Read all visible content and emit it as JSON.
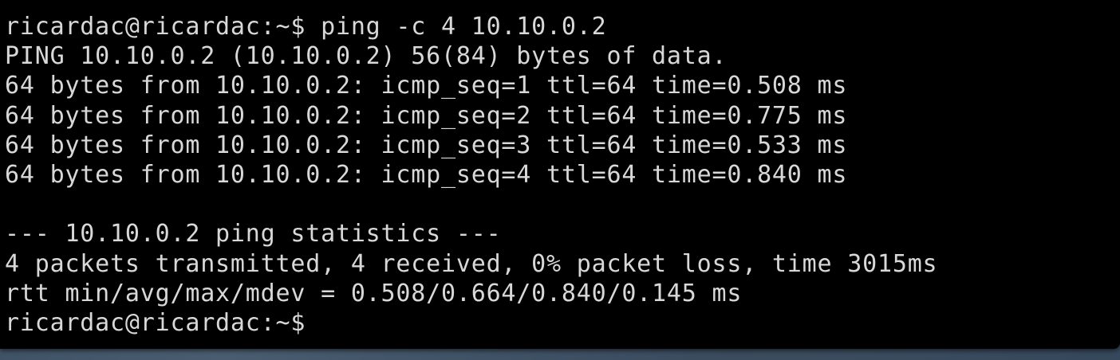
{
  "terminal": {
    "lines": [
      "ricardac@ricardac:~$ ping -c 4 10.10.0.2",
      "PING 10.10.0.2 (10.10.0.2) 56(84) bytes of data.",
      "64 bytes from 10.10.0.2: icmp_seq=1 ttl=64 time=0.508 ms",
      "64 bytes from 10.10.0.2: icmp_seq=2 ttl=64 time=0.775 ms",
      "64 bytes from 10.10.0.2: icmp_seq=3 ttl=64 time=0.533 ms",
      "64 bytes from 10.10.0.2: icmp_seq=4 ttl=64 time=0.840 ms",
      "",
      "--- 10.10.0.2 ping statistics ---",
      "4 packets transmitted, 4 received, 0% packet loss, time 3015ms",
      "rtt min/avg/max/mdev = 0.508/0.664/0.840/0.145 ms",
      "ricardac@ricardac:~$"
    ],
    "colors": {
      "background": "#000000",
      "foreground": "#d8d8d8"
    }
  }
}
